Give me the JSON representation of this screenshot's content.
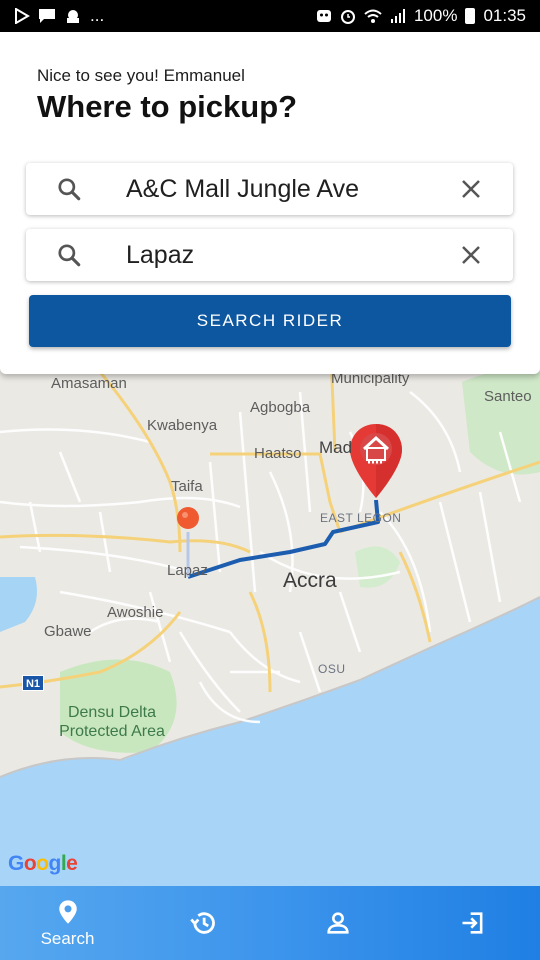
{
  "status_bar": {
    "battery": "100%",
    "time": "01:35",
    "left_icons": [
      "play-store-icon",
      "message-icon",
      "android-icon",
      "more-dots"
    ],
    "right_icons": [
      "notification-icon",
      "alarm-icon",
      "wifi-icon",
      "signal-icon",
      "battery-icon"
    ]
  },
  "header": {
    "greeting": "Nice to see you! Emmanuel",
    "title": "Where to pickup?"
  },
  "pickup": {
    "value": "A&C Mall Jungle Ave",
    "icon": "search-icon",
    "clear_icon": "close-icon"
  },
  "destination": {
    "value": "Lapaz",
    "icon": "search-icon",
    "clear_icon": "close-icon"
  },
  "search_button": {
    "label": "SEARCH RIDER"
  },
  "map": {
    "labels": {
      "amasaman": "Amasaman",
      "municipality": "Municipality",
      "santeo": "Santeo",
      "agbogba": "Agbogba",
      "kwabenya": "Kwabenya",
      "haatso": "Haatso",
      "madina": "Mad",
      "taifa": "Taifa",
      "east_legon": "EAST LEGON",
      "lapaz": "Lapaz",
      "accra": "Accra",
      "awoshie": "Awoshie",
      "gbawe": "Gbawe",
      "osu": "OSU",
      "densu": "Densu Delta Protected Area",
      "road_badge": "N1"
    },
    "google": [
      "G",
      "o",
      "o",
      "g",
      "l",
      "e"
    ],
    "colors": {
      "route": "#1c5db0",
      "pin_red": "#e53935",
      "water": "#a6d4f5",
      "park": "#c6e6bd"
    }
  },
  "bottom_nav": {
    "items": [
      {
        "icon": "location-pin-icon",
        "label": "Search"
      },
      {
        "icon": "history-icon",
        "label": ""
      },
      {
        "icon": "person-icon",
        "label": ""
      },
      {
        "icon": "logout-icon",
        "label": ""
      }
    ]
  }
}
